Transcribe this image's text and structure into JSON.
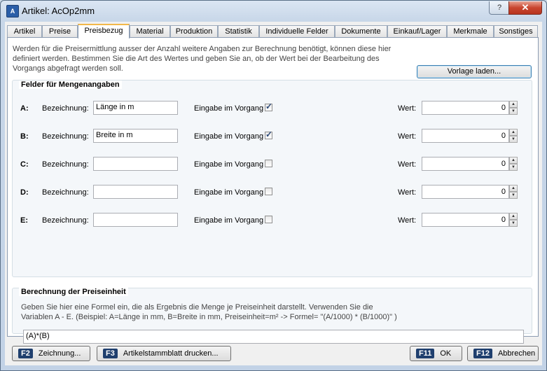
{
  "window": {
    "title": "Artikel: AcOp2mm",
    "help_label": "?",
    "close_label": "✕"
  },
  "tabs": [
    {
      "label": "Artikel"
    },
    {
      "label": "Preise"
    },
    {
      "label": "Preisbezug"
    },
    {
      "label": "Material"
    },
    {
      "label": "Produktion"
    },
    {
      "label": "Statistik"
    },
    {
      "label": "Individuelle Felder"
    },
    {
      "label": "Dokumente"
    },
    {
      "label": "Einkauf/Lager"
    },
    {
      "label": "Merkmale"
    },
    {
      "label": "Sonstiges"
    }
  ],
  "active_tab": "Preisbezug",
  "intro": {
    "line1": "Werden für die Preisermittlung ausser der Anzahl weitere Angaben zur Berechnung benötigt, können diese hier",
    "line2": "definiert werden. Bestimmen Sie die Art des Wertes und geben Sie an, ob der Wert bei der Bearbeitung des",
    "line3": "Vorgangs abgefragt werden soll."
  },
  "load_template_button": "Vorlage laden...",
  "fields_group": {
    "title": "Felder für Mengenangaben",
    "designation_label": "Bezeichnung:",
    "input_label": "Eingabe im Vorgang",
    "value_label": "Wert:",
    "rows": [
      {
        "letter": "A:",
        "designation": "Länge in m",
        "checked": true,
        "value": "0"
      },
      {
        "letter": "B:",
        "designation": "Breite in m",
        "checked": true,
        "value": "0"
      },
      {
        "letter": "C:",
        "designation": "",
        "checked": false,
        "value": "0"
      },
      {
        "letter": "D:",
        "designation": "",
        "checked": false,
        "value": "0"
      },
      {
        "letter": "E:",
        "designation": "",
        "checked": false,
        "value": "0"
      }
    ]
  },
  "formula_group": {
    "title": "Berechnung der Preiseinheit",
    "desc_line1": "Geben Sie hier eine Formel ein, die als Ergebnis die Menge je Preiseinheit darstellt. Verwenden Sie die",
    "desc_line2": "Variablen A - E. (Beispiel: A=Länge in mm, B=Breite in mm, Preiseinheit=m² -> Formel= \"(A/1000) * (B/1000)\" )",
    "formula": "(A)*(B)"
  },
  "footer": {
    "drawing": {
      "key": "F2",
      "label": "Zeichnung..."
    },
    "print": {
      "key": "F3",
      "label": "Artikelstammblatt drucken..."
    },
    "ok": {
      "key": "F11",
      "label": "OK"
    },
    "cancel": {
      "key": "F12",
      "label": "Abbrechen"
    }
  }
}
